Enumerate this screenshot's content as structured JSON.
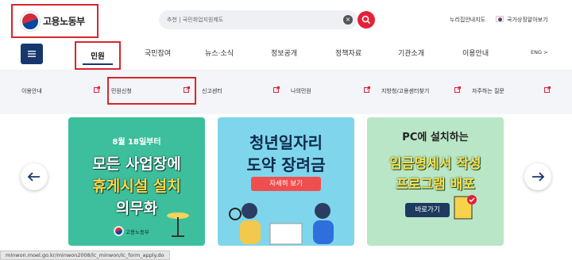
{
  "header": {
    "logo_text": "고용노동부",
    "search_placeholder": "추천 | 국민취업지원제도",
    "util_link_1": "누리집안내지도",
    "util_link_2": "국가상징알아보기"
  },
  "nav": {
    "items": [
      "민원",
      "국민참여",
      "뉴스·소식",
      "정보공개",
      "정책자료",
      "기관소개",
      "이용안내"
    ],
    "lang": "ENG >"
  },
  "submenu": {
    "items": [
      "이용안내",
      "민원신청",
      "신고센터",
      "나의민원",
      "지방청/고용센터찾기",
      "자주하는 질문"
    ]
  },
  "banners": [
    {
      "line1": "8월 18일부터",
      "line2": "모든 사업장에",
      "line3": "휴게시설 설치",
      "line4": "의무화",
      "footer": "고용노동부"
    },
    {
      "line1": "청년일자리",
      "line2": "도약 장려금",
      "button": "자세히 보기"
    },
    {
      "line1": "PC에 설치하는",
      "line2": "임금명세서 작성",
      "line3": "프로그램 배포",
      "button": "바로가기"
    }
  ],
  "status_url": "minwon.moel.go.kr/minwon2008/lc_minwon/lc_form_apply.do",
  "colors": {
    "brand_navy": "#17376f",
    "accent_red": "#e5203a",
    "highlight_box": "#d8262c"
  }
}
